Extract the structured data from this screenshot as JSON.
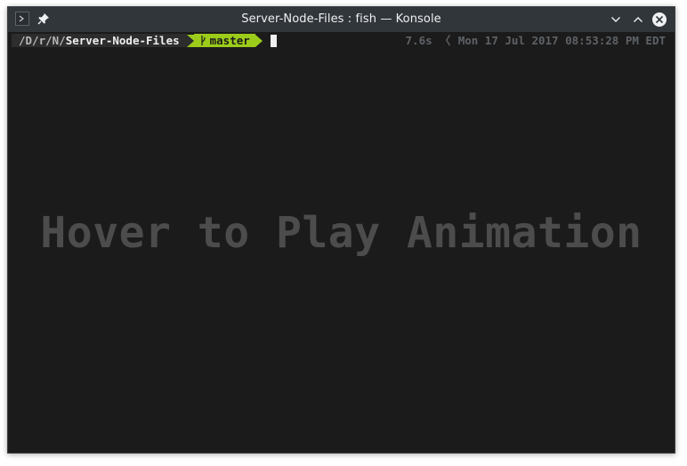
{
  "window": {
    "title": "Server-Node-Files : fish — Konsole",
    "icons": {
      "app": "terminal-icon",
      "pin": "pin-icon",
      "minimize": "chevron-down-icon",
      "maximize": "chevron-up-icon",
      "close": "close-icon"
    }
  },
  "prompt": {
    "path_dirs": "/D/r/N/",
    "path_current": "Server-Node-Files",
    "git_branch_icon": "git-branch-icon",
    "git_branch": "master"
  },
  "right_prompt": {
    "duration": "7.6s",
    "separator": "〈",
    "timestamp": "Mon 17 Jul 2017 08:53:28 PM EDT"
  },
  "overlay": {
    "text": "Hover to Play Animation"
  },
  "colors": {
    "titlebar_bg": "#31363b",
    "terminal_bg": "#1b1b1b",
    "path_segment_bg": "#2d2d2d",
    "git_segment_bg": "#9ccc1a",
    "right_prompt_text": "#5e6266",
    "overlay_text": "#4c4c4c"
  }
}
